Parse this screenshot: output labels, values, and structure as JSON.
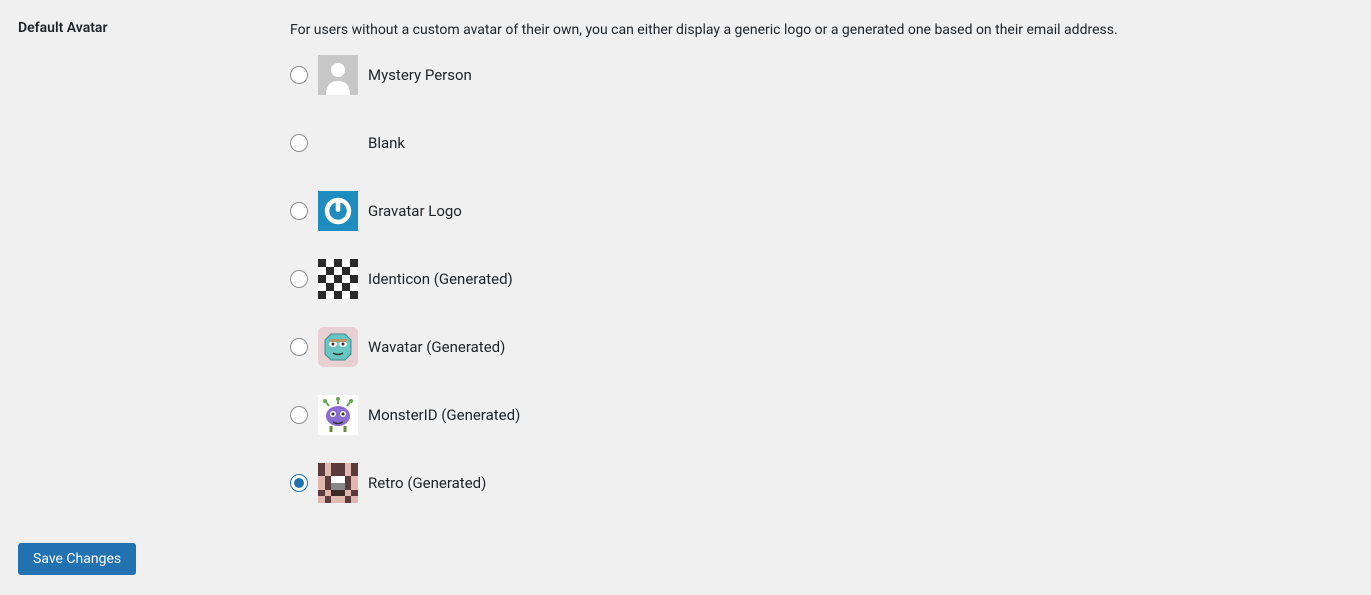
{
  "section": {
    "title": "Default Avatar",
    "description": "For users without a custom avatar of their own, you can either display a generic logo or a generated one based on their email address."
  },
  "options": [
    {
      "key": "mystery",
      "label": "Mystery Person",
      "selected": false
    },
    {
      "key": "blank",
      "label": "Blank",
      "selected": false
    },
    {
      "key": "gravatar",
      "label": "Gravatar Logo",
      "selected": false
    },
    {
      "key": "identicon",
      "label": "Identicon (Generated)",
      "selected": false
    },
    {
      "key": "wavatar",
      "label": "Wavatar (Generated)",
      "selected": false
    },
    {
      "key": "monsterid",
      "label": "MonsterID (Generated)",
      "selected": false
    },
    {
      "key": "retro",
      "label": "Retro (Generated)",
      "selected": true
    }
  ],
  "submit": {
    "label": "Save Changes"
  }
}
